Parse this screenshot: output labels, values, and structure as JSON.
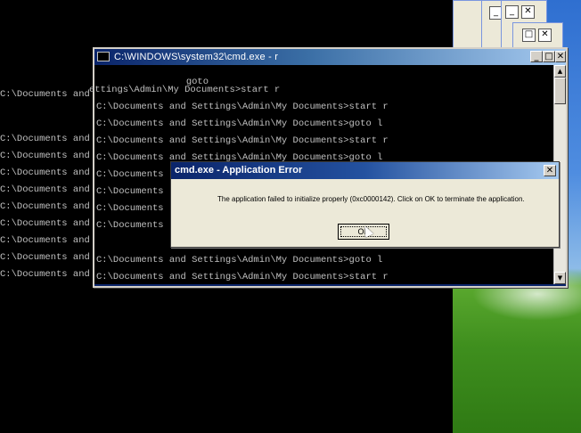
{
  "cmd_window": {
    "title": "C:\\WINDOWS\\system32\\cmd.exe - r",
    "lines": [
      "                goto",
      "ettings\\Admin\\My Documents>start r",
      "C:\\Documents and Settings\\Admin\\My Documents>start r",
      "C:\\Documents and Settings\\Admin\\My Documents>goto l",
      "C:\\Documents and Settings\\Admin\\My Documents>start r",
      "C:\\Documents and Settings\\Admin\\My Documents>goto l",
      "C:\\Documents",
      "C:\\Documents",
      "C:\\Documents",
      "C:\\Documents",
      "C:\\Documents and Settings\\Admin\\My Documents>goto l",
      "C:\\Documents and Settings\\Admin\\My Documents>start r"
    ]
  },
  "background_console": {
    "lines": [
      "C:\\Documents and !",
      "C:\\Documents and",
      "C:\\Documents and",
      "C:\\Documents and",
      "C:\\Documents and",
      "C:\\Documents and",
      "C:\\Documents and",
      "C:\\Documents and",
      "C:\\Documents and",
      "C:\\Documents and",
      "C:\\Documents and"
    ]
  },
  "dialog": {
    "title": "cmd.exe - Application Error",
    "message": "The application failed to initialize properly (0xc0000142). Click on OK to terminate the application.",
    "ok_label": "OK"
  },
  "icons": {
    "close": "close-icon",
    "minimize": "minimize-icon",
    "maximize": "maximize-icon"
  }
}
